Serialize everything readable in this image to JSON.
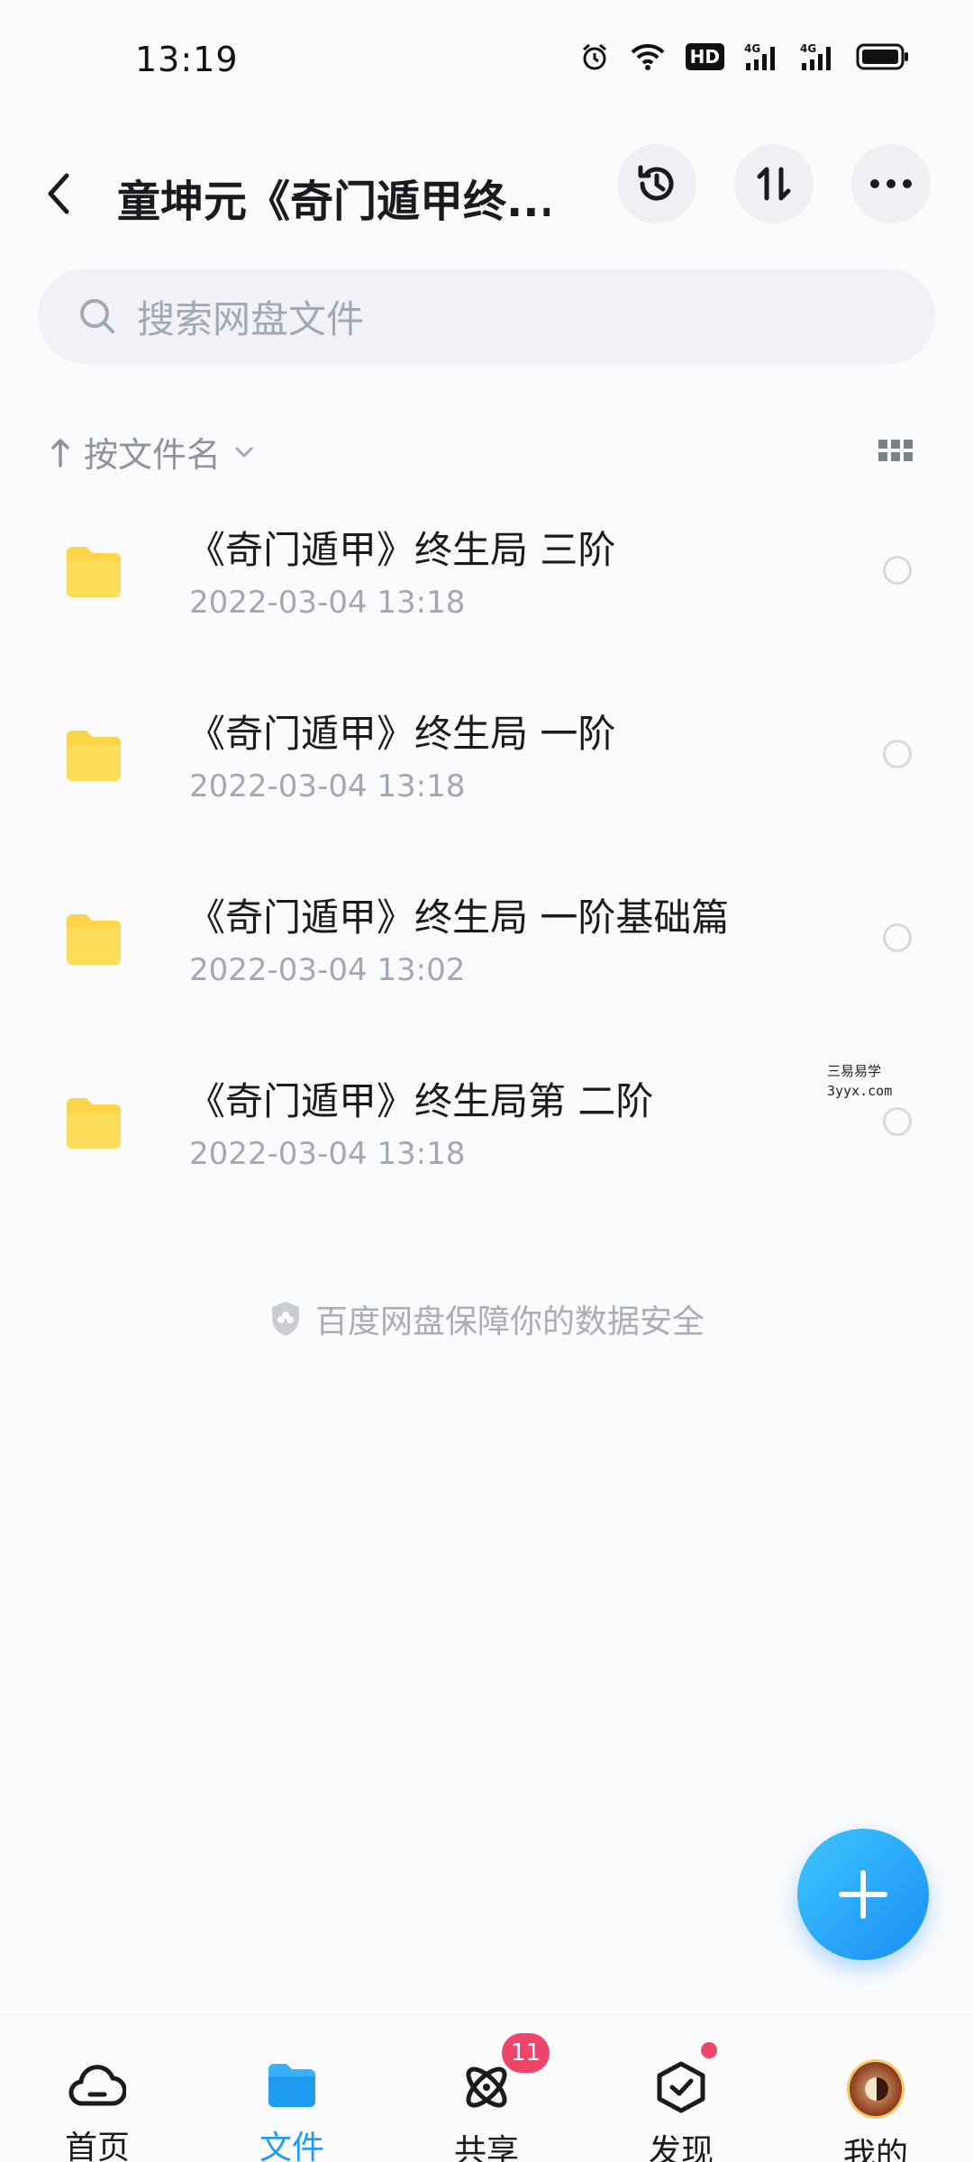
{
  "status_bar": {
    "time": "13:19",
    "icons": [
      "alarm-icon",
      "wifi-icon",
      "hd-icon",
      "signal-4g-icon",
      "signal-4g-icon",
      "battery-icon"
    ],
    "hd_label": "HD",
    "network_label": "4G"
  },
  "header": {
    "title": "童坤元《奇门遁甲终...",
    "buttons": [
      "history-icon",
      "sort-icon",
      "more-icon"
    ]
  },
  "search": {
    "placeholder": "搜索网盘文件"
  },
  "sort": {
    "label": "按文件名"
  },
  "files": [
    {
      "name": "《奇门遁甲》终生局 三阶",
      "date": "2022-03-04  13:18"
    },
    {
      "name": "《奇门遁甲》终生局 一阶",
      "date": "2022-03-04  13:18"
    },
    {
      "name": "《奇门遁甲》终生局 一阶基础篇",
      "date": "2022-03-04  13:02"
    },
    {
      "name": "《奇门遁甲》终生局第 二阶",
      "date": "2022-03-04  13:18"
    }
  ],
  "watermark": {
    "line1": "三易易学",
    "line2": "3yyx.com"
  },
  "security_note": "百度网盘保障你的数据安全",
  "bottom_nav": [
    {
      "label": "首页",
      "icon": "cloud-home-icon",
      "active": false
    },
    {
      "label": "文件",
      "icon": "folder-icon",
      "active": true
    },
    {
      "label": "共享",
      "icon": "share-atom-icon",
      "active": false,
      "badge": "11"
    },
    {
      "label": "发现",
      "icon": "discover-box-icon",
      "active": false,
      "dot": true
    },
    {
      "label": "我的",
      "icon": "avatar",
      "active": false
    }
  ],
  "colors": {
    "accent": "#1e9bf0",
    "folder": "#fcd54a",
    "badge": "#f0456a"
  }
}
